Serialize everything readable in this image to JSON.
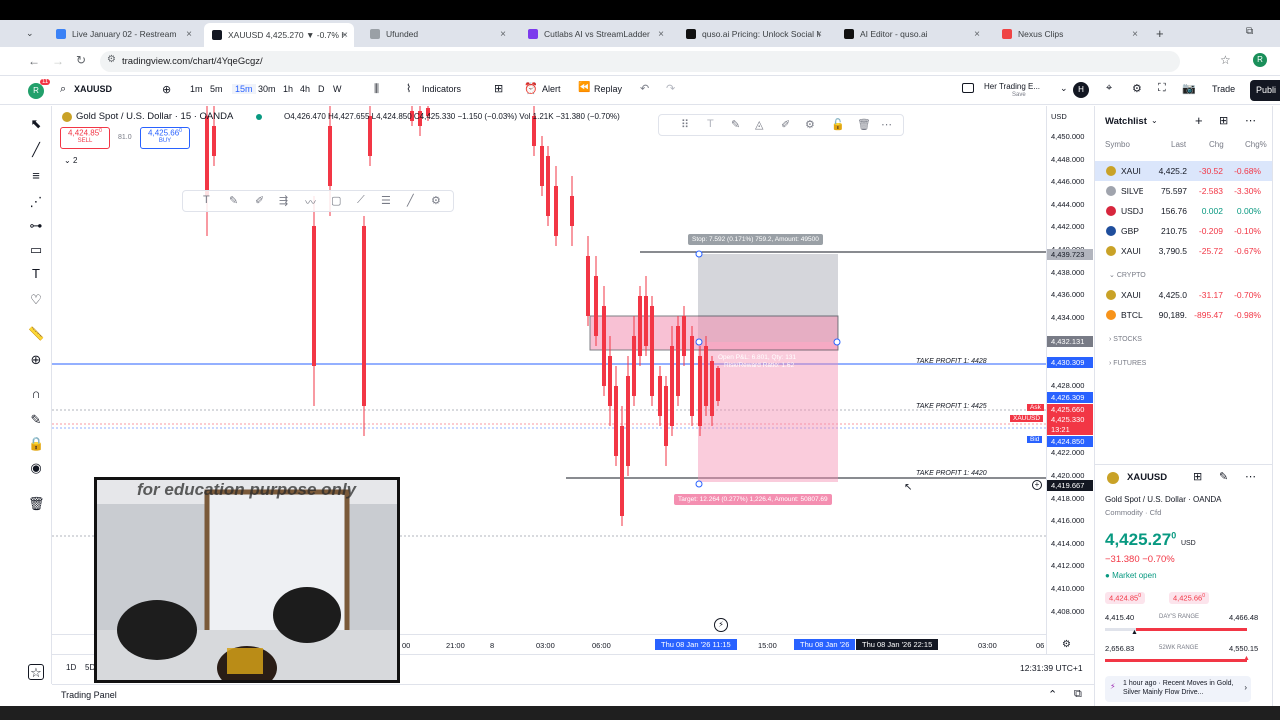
{
  "browser": {
    "tabs": [
      {
        "label": "Live January 02 - Restream",
        "color": "#3b82f6"
      },
      {
        "label": "XAUUSD 4,425.270 ▼ -0.7% H",
        "color": "#131722"
      },
      {
        "label": "Ufunded",
        "color": "#9aa0a6"
      },
      {
        "label": "Cutlabs AI vs StreamLadder",
        "color": "#7c3aed"
      },
      {
        "label": "quso.ai Pricing: Unlock Social M",
        "color": "#111111"
      },
      {
        "label": "AI Editor - quso.ai",
        "color": "#111111"
      },
      {
        "label": "Nexus Clips",
        "color": "#ef4444"
      }
    ],
    "url": "tradingview.com/chart/4YqeGcgz/"
  },
  "toolbar": {
    "symbol": "XAUUSD",
    "intervals": [
      "1m",
      "5m",
      "15m",
      "30m",
      "1h",
      "4h",
      "D",
      "W"
    ],
    "indicators": "Indicators",
    "alert": "Alert",
    "replay": "Replay",
    "layout_name": "Her Trading E...",
    "save": "Save",
    "trade": "Trade",
    "publish": "Publi",
    "avatar_letter": "R",
    "notif_count": "11",
    "profile_letter": "H"
  },
  "legend": {
    "title": "Gold Spot / U.S. Dollar · 15 · OANDA",
    "ohlc": "O4,426.470 H4,427.655 L4,424.850 C4,425.330 −1.150 (−0.03%) Vol 1.21K −31.380 (−0.70%)",
    "sell_price": "4,424.85",
    "sell_sup": "0",
    "sell_label": "SELL",
    "spread": "81.0",
    "buy_price": "4,425.66",
    "buy_sup": "0",
    "buy_label": "BUY",
    "indicator_count": "2"
  },
  "position": {
    "stop": "Stop: 7.592 (0.171%) 759.2, Amount: 49500",
    "open": "Open P&L: 6.801, Qty: 131",
    "rr": "Risk/Reward Ratio: 1.62",
    "target": "Target: 12.264 (0.277%) 1,226.4, Amount: 50807.69"
  },
  "tp_labels": [
    "TAKE PROFIT 1: 4428",
    "TAKE PROFIT 1: 4425",
    "TAKE PROFIT 1: 4420"
  ],
  "price_axis": {
    "currency": "USD",
    "ticks": [
      "4,450.000",
      "4,448.000",
      "4,446.000",
      "4,444.000",
      "4,442.000",
      "4,440.000",
      "4,438.000",
      "4,436.000",
      "4,434.000",
      "4,432.000",
      "4,430.000",
      "4,428.000",
      "4,426.000",
      "4,424.000",
      "4,422.000",
      "4,420.000",
      "4,418.000",
      "4,416.000",
      "4,414.000",
      "4,412.000",
      "4,410.000",
      "4,408.000"
    ],
    "badges": {
      "stop": "4,439.723",
      "entry": "4,432.131",
      "tp": "4,430.309",
      "cur": "4,426.309",
      "ask": "4,425.660",
      "sym": "XAUUSD",
      "last": "4,425.330",
      "time": "13:21",
      "bid": "4,424.850",
      "target": "4,419.667"
    },
    "ask_label": "Ask",
    "bid_label": "Bid"
  },
  "time_axis": {
    "ticks": [
      "00",
      "21:00",
      "8",
      "03:00",
      "06:00",
      "15:00",
      "03:00",
      "06"
    ],
    "highlight1": "Thu 08 Jan '26  11:15",
    "highlight2": "Thu 08 Jan '26",
    "highlight3": "Thu 08 Jan '26  22:15"
  },
  "bottom": {
    "ranges": [
      "1D",
      "5D",
      "1M",
      "3M",
      "6M",
      "YTD",
      "1Y",
      "5Y"
    ],
    "clock": "12:31:39 UTC+1",
    "trading_panel": "Trading Panel"
  },
  "watchlist": {
    "title": "Watchlist",
    "headers": [
      "Symbo",
      "Last",
      "Chg",
      "Chg%"
    ],
    "rows": [
      {
        "sym": "XAUI",
        "last": "4,425.2",
        "chg": "-30.52",
        "chgp": "-0.68%",
        "color": "#c9a227",
        "sel": true,
        "dir": "neg"
      },
      {
        "sym": "SILVE",
        "last": "75.597",
        "chg": "-2.583",
        "chgp": "-3.30%",
        "color": "#a0a4ad",
        "sel": false,
        "dir": "neg"
      },
      {
        "sym": "USDJ",
        "last": "156.76",
        "chg": "0.002",
        "chgp": "0.00%",
        "color": "#d7263d",
        "sel": false,
        "dir": "pos"
      },
      {
        "sym": "GBP",
        "last": "210.75",
        "chg": "-0.209",
        "chgp": "-0.10%",
        "color": "#1f4e9c",
        "sel": false,
        "dir": "neg"
      },
      {
        "sym": "XAUI",
        "last": "3,790.5",
        "chg": "-25.72",
        "chgp": "-0.67%",
        "color": "#c9a227",
        "sel": false,
        "dir": "neg"
      }
    ],
    "crypto_label": "CRYPTO",
    "crypto": [
      {
        "sym": "XAUI",
        "last": "4,425.0",
        "chg": "-31.17",
        "chgp": "-0.70%",
        "color": "#c9a227",
        "sel": false,
        "dir": "neg"
      },
      {
        "sym": "BTCL",
        "last": "90,189.",
        "chg": "-895.47",
        "chgp": "-0.98%",
        "color": "#f7931a",
        "sel": false,
        "dir": "neg"
      }
    ],
    "stocks_label": "STOCKS",
    "futures_label": "FUTURES"
  },
  "details": {
    "symbol": "XAUUSD",
    "name": "Gold Spot / U.S. Dollar",
    "exchange": "OANDA",
    "type": "Commodity · Cfd",
    "price": "4,425.27",
    "price_sup": "0",
    "currency": "USD",
    "change": "−31.380 −0.70%",
    "market": "Market open",
    "bid": "4,424.85",
    "bid_sup": "0",
    "ask": "4,425.66",
    "ask_sup": "0",
    "day_low": "4,415.40",
    "day_label": "DAY'S RANGE",
    "day_high": "4,466.48",
    "wk_low": "2,656.83",
    "wk_label": "52WK RANGE",
    "wk_high": "4,550.15",
    "news": "1 hour ago · Recent Moves in Gold, Silver Mainly Flow Drive..."
  },
  "webcam": {
    "overlay_text": "for education purpose only"
  }
}
